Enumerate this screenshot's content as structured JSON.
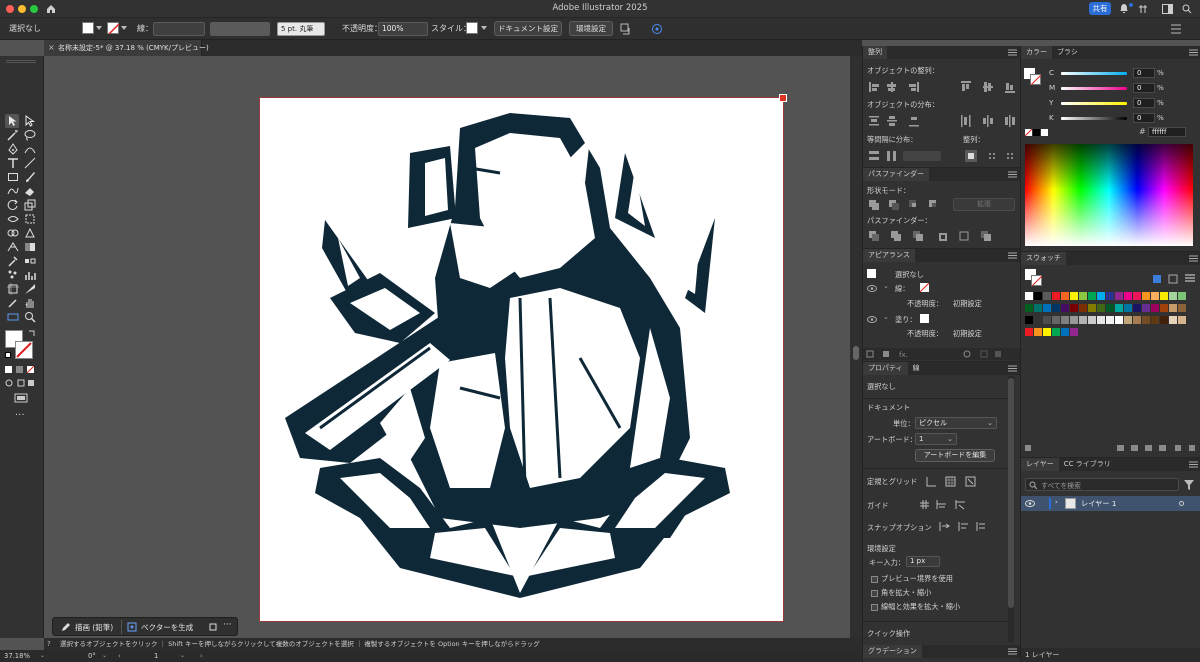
{
  "window": {
    "title": "Adobe Illustrator 2025",
    "share_label": "共有"
  },
  "controlbar": {
    "selection": "選択なし",
    "stroke_label": "線：",
    "brush": "5 pt. 丸筆",
    "opacity_label": "不透明度：",
    "opacity_value": "100%",
    "style_label": "スタイル：",
    "doc_setup": "ドキュメント設定",
    "env_setup": "環境設定"
  },
  "document_tab": {
    "title": "名称未設定-5* @ 37.18 % (CMYK/プレビュー)"
  },
  "context_bar": {
    "draw_label": "描画 (鉛筆)",
    "vector_label": "ベクターを生成"
  },
  "statusbar": {
    "hint": "選択するオブジェクトをクリック ｜ Shift キーを押しながらクリックして複数のオブジェクトを選択 ｜ 複製するオブジェクトを Option キーを押しながらドラッグ"
  },
  "footer": {
    "zoom": "37.18%",
    "rotation": "0°",
    "artboard": "1"
  },
  "align_panel": {
    "tab": "整列",
    "align_objects": "オブジェクトの整列：",
    "distribute_objects": "オブジェクトの分布：",
    "distribute_spacing": "等間隔に分布：",
    "align_to": "整列："
  },
  "pathfinder_panel": {
    "tab": "パスファインダー",
    "shape_modes": "形状モード：",
    "expand": "拡張",
    "pathfinders": "パスファインダー："
  },
  "appearance_panel": {
    "tab": "アピアランス",
    "no_selection": "選択なし",
    "stroke": "線：",
    "opacity": "不透明度：",
    "default": "初期設定",
    "fill": "塗り：",
    "opacity2": "不透明度：",
    "default2": "初期設定"
  },
  "properties_panel": {
    "tabs": [
      "プロパティ",
      "線"
    ],
    "no_selection": "選択なし",
    "document": "ドキュメント",
    "unit_label": "単位：",
    "unit_value": "ピクセル",
    "artboard_label": "アートボード：",
    "artboard_value": "1",
    "edit_artboard": "アートボードを編集",
    "rulers_grids": "定規とグリッド",
    "guides": "ガイド",
    "snap_options": "スナップオプション",
    "preferences": "環境設定",
    "key_increment_label": "キー入力：",
    "key_increment_value": "1 px",
    "preview_bounds": "プレビュー境界を使用",
    "scale_corners": "角を拡大・縮小",
    "scale_strokes": "線幅と効果を拡大・縮小",
    "quick_actions": "クイック操作"
  },
  "gradient_tab": "グラデーション",
  "color_panel": {
    "tabs": [
      "カラー",
      "ブラシ"
    ],
    "channels": [
      {
        "label": "C",
        "value": "0",
        "unit": "%"
      },
      {
        "label": "M",
        "value": "0",
        "unit": "%"
      },
      {
        "label": "Y",
        "value": "0",
        "unit": "%"
      },
      {
        "label": "K",
        "value": "0",
        "unit": "%"
      }
    ],
    "hex": "ffffff"
  },
  "swatches_panel": {
    "tab": "スウォッチ"
  },
  "layers_panel": {
    "tabs": [
      "レイヤー",
      "CC ライブラリ"
    ],
    "search_placeholder": "すべてを検索",
    "layer_name": "レイヤー 1",
    "footer": "1 レイヤー"
  },
  "colors": {
    "ui_bg": "#323232",
    "canvas": "#535353",
    "art": "#0f2838",
    "accent": "#2b6dd6"
  }
}
